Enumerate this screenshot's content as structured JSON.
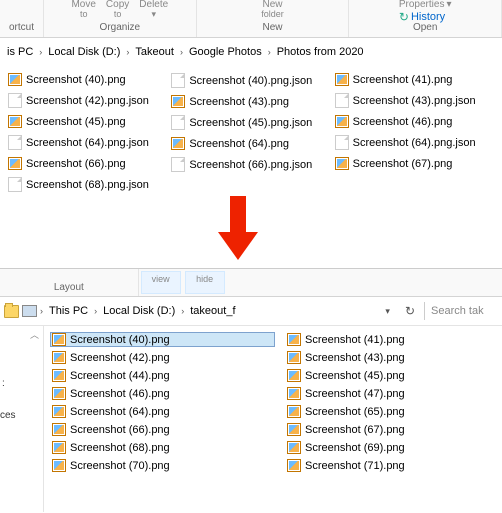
{
  "top_toolbar": {
    "btn1_l1": "Move",
    "btn1_l2": "to",
    "btn2_l1": "Copy",
    "btn2_l2": "to",
    "btn3_l1": "Delete",
    "btn3_l2": "",
    "btn4_l1": "New",
    "btn4_l2": "folder",
    "btn5_l1": "Properties",
    "btn5_l2": "",
    "history": "History",
    "group_organize": "Organize",
    "group_new": "New",
    "group_open": "Open",
    "sidebar_label": "ortcut"
  },
  "breadcrumb_top": [
    "is PC",
    "Local Disk (D:)",
    "Takeout",
    "Google Photos",
    "Photos from 2020"
  ],
  "files_top": {
    "col1": [
      {
        "name": "Screenshot (40).png",
        "t": "img"
      },
      {
        "name": "Screenshot (42).png.json",
        "t": "json"
      },
      {
        "name": "Screenshot (45).png",
        "t": "img"
      },
      {
        "name": "Screenshot (64).png.json",
        "t": "json"
      },
      {
        "name": "Screenshot (66).png",
        "t": "img"
      },
      {
        "name": "Screenshot (68).png.json",
        "t": "json"
      }
    ],
    "col2": [
      {
        "name": "Screenshot (40).png.json",
        "t": "json"
      },
      {
        "name": "Screenshot (43).png",
        "t": "img"
      },
      {
        "name": "Screenshot (45).png.json",
        "t": "json"
      },
      {
        "name": "Screenshot (64).png",
        "t": "img"
      },
      {
        "name": "Screenshot (66).png.json",
        "t": "json"
      }
    ],
    "col3": [
      {
        "name": "Screenshot (41).png",
        "t": "img"
      },
      {
        "name": "Screenshot (43).png.json",
        "t": "json"
      },
      {
        "name": "Screenshot (46).png",
        "t": "img"
      },
      {
        "name": "Screenshot (64).png.json",
        "t": "json"
      },
      {
        "name": "Screenshot (67).png",
        "t": "img"
      }
    ]
  },
  "lower_ribbon": {
    "layout": "Layout",
    "view": "view",
    "hide": "hide"
  },
  "breadcrumb_lower": [
    "This PC",
    "Local Disk (D:)",
    "takeout_f"
  ],
  "search_placeholder": "Search tak",
  "lower_side": {
    "l1": ":",
    "l2": "ces"
  },
  "files_lower": {
    "col1": [
      {
        "name": "Screenshot (40).png",
        "sel": true
      },
      {
        "name": "Screenshot (42).png"
      },
      {
        "name": "Screenshot (44).png"
      },
      {
        "name": "Screenshot (46).png"
      },
      {
        "name": "Screenshot (64).png"
      },
      {
        "name": "Screenshot (66).png"
      },
      {
        "name": "Screenshot (68).png"
      },
      {
        "name": "Screenshot (70).png"
      }
    ],
    "col2": [
      {
        "name": "Screenshot (41).png"
      },
      {
        "name": "Screenshot (43).png"
      },
      {
        "name": "Screenshot (45).png"
      },
      {
        "name": "Screenshot (47).png"
      },
      {
        "name": "Screenshot (65).png"
      },
      {
        "name": "Screenshot (67).png"
      },
      {
        "name": "Screenshot (69).png"
      },
      {
        "name": "Screenshot (71).png"
      }
    ]
  }
}
